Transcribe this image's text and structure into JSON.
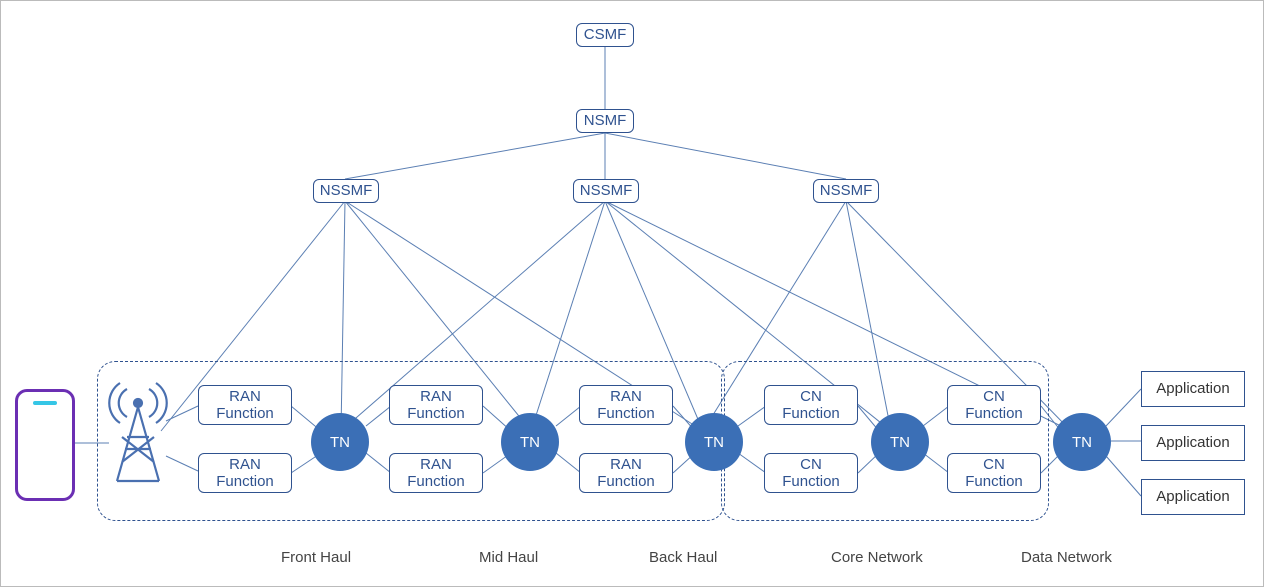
{
  "hierarchy": {
    "csmf": "CSMF",
    "nsmf": "NSMF",
    "nssmf": [
      "NSSMF",
      "NSSMF",
      "NSSMF"
    ]
  },
  "ran_functions": {
    "col1": [
      "RAN Function",
      "RAN Function"
    ],
    "col2": [
      "RAN Function",
      "RAN Function"
    ],
    "col3": [
      "RAN Function",
      "RAN Function"
    ]
  },
  "cn_functions": {
    "col1": [
      "CN Function",
      "CN Function"
    ],
    "col2": [
      "CN Function",
      "CN Function"
    ]
  },
  "tn_label": "TN",
  "applications": [
    "Application",
    "Application",
    "Application"
  ],
  "segments": [
    "Front Haul",
    "Mid Haul",
    "Back Haul",
    "Core Network",
    "Data Network"
  ],
  "icons": {
    "ue": "user-equipment",
    "antenna": "antenna-tower"
  }
}
